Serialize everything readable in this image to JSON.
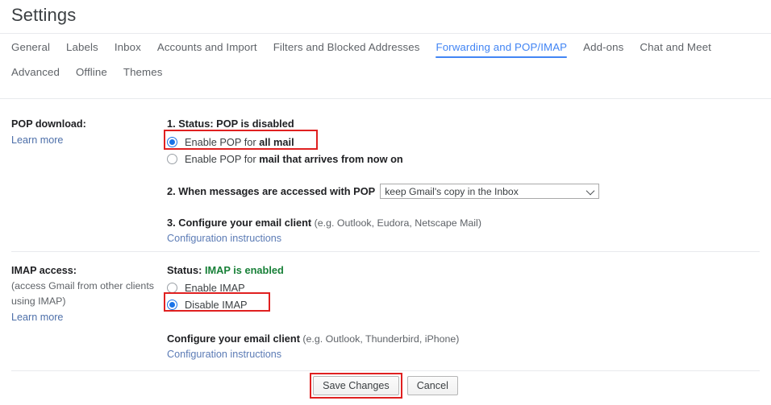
{
  "header": {
    "title": "Settings"
  },
  "tabs": {
    "row1": [
      {
        "label": "General",
        "active": false
      },
      {
        "label": "Labels",
        "active": false
      },
      {
        "label": "Inbox",
        "active": false
      },
      {
        "label": "Accounts and Import",
        "active": false
      },
      {
        "label": "Filters and Blocked Addresses",
        "active": false
      },
      {
        "label": "Forwarding and POP/IMAP",
        "active": true
      },
      {
        "label": "Add-ons",
        "active": false
      },
      {
        "label": "Chat and Meet",
        "active": false
      }
    ],
    "row2": [
      {
        "label": "Advanced",
        "active": false
      },
      {
        "label": "Offline",
        "active": false
      },
      {
        "label": "Themes",
        "active": false
      }
    ],
    "active_color": "#4285f4"
  },
  "pop": {
    "label": "POP download:",
    "learn_more": "Learn more",
    "status_line": "1. Status: POP is disabled",
    "option_all_prefix": "Enable POP for ",
    "option_all_bold": "all mail",
    "option_now_prefix": "Enable POP for ",
    "option_now_bold": "mail that arrives from now on",
    "selected": "all mail",
    "step2_label": "2. When messages are accessed with POP",
    "step2_value": "keep Gmail's copy in the Inbox",
    "step3_bold": "3. Configure your email client",
    "step3_note": " (e.g. Outlook, Eudora, Netscape Mail)",
    "config_link": "Configuration instructions"
  },
  "imap": {
    "label": "IMAP access:",
    "note_line1": "(access Gmail from other clients",
    "note_line2": "using IMAP)",
    "learn_more": "Learn more",
    "status_prefix": "Status: ",
    "status_value": "IMAP is enabled",
    "status_color": "#188038",
    "option_enable": "Enable IMAP",
    "option_disable": "Disable IMAP",
    "selected": "Disable IMAP",
    "config_bold": "Configure your email client",
    "config_note": " (e.g. Outlook, Thunderbird, iPhone)",
    "config_link": "Configuration instructions"
  },
  "footer": {
    "save_label": "Save Changes",
    "cancel_label": "Cancel"
  },
  "annotations": {
    "color": "#e02020"
  }
}
